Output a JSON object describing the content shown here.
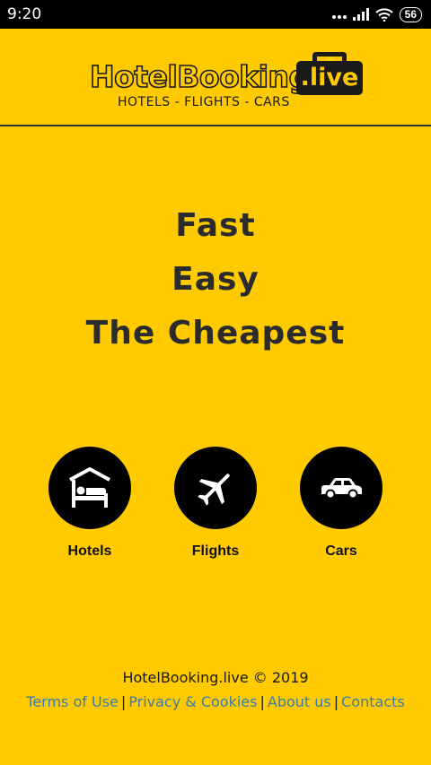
{
  "status_bar": {
    "time": "9:20",
    "battery": "56"
  },
  "header": {
    "logo_name": "HotelBooking",
    "logo_tld": ".live",
    "tagline": "HOTELS - FLIGHTS - CARS"
  },
  "hero": {
    "line1": "Fast",
    "line2": "Easy",
    "line3": "The Cheapest"
  },
  "services": {
    "hotels": {
      "label": "Hotels",
      "icon": "hotel-bed-icon"
    },
    "flights": {
      "label": "Flights",
      "icon": "airplane-icon"
    },
    "cars": {
      "label": "Cars",
      "icon": "car-icon"
    }
  },
  "footer": {
    "copyright": "HotelBooking.live © 2019",
    "links": {
      "terms": "Terms of Use",
      "privacy": "Privacy & Cookies",
      "about": "About us",
      "contacts": "Contacts"
    },
    "separator": "|"
  },
  "colors": {
    "background": "#FFCA00",
    "dark": "#1a1a1a",
    "link": "#3a7ca8"
  }
}
